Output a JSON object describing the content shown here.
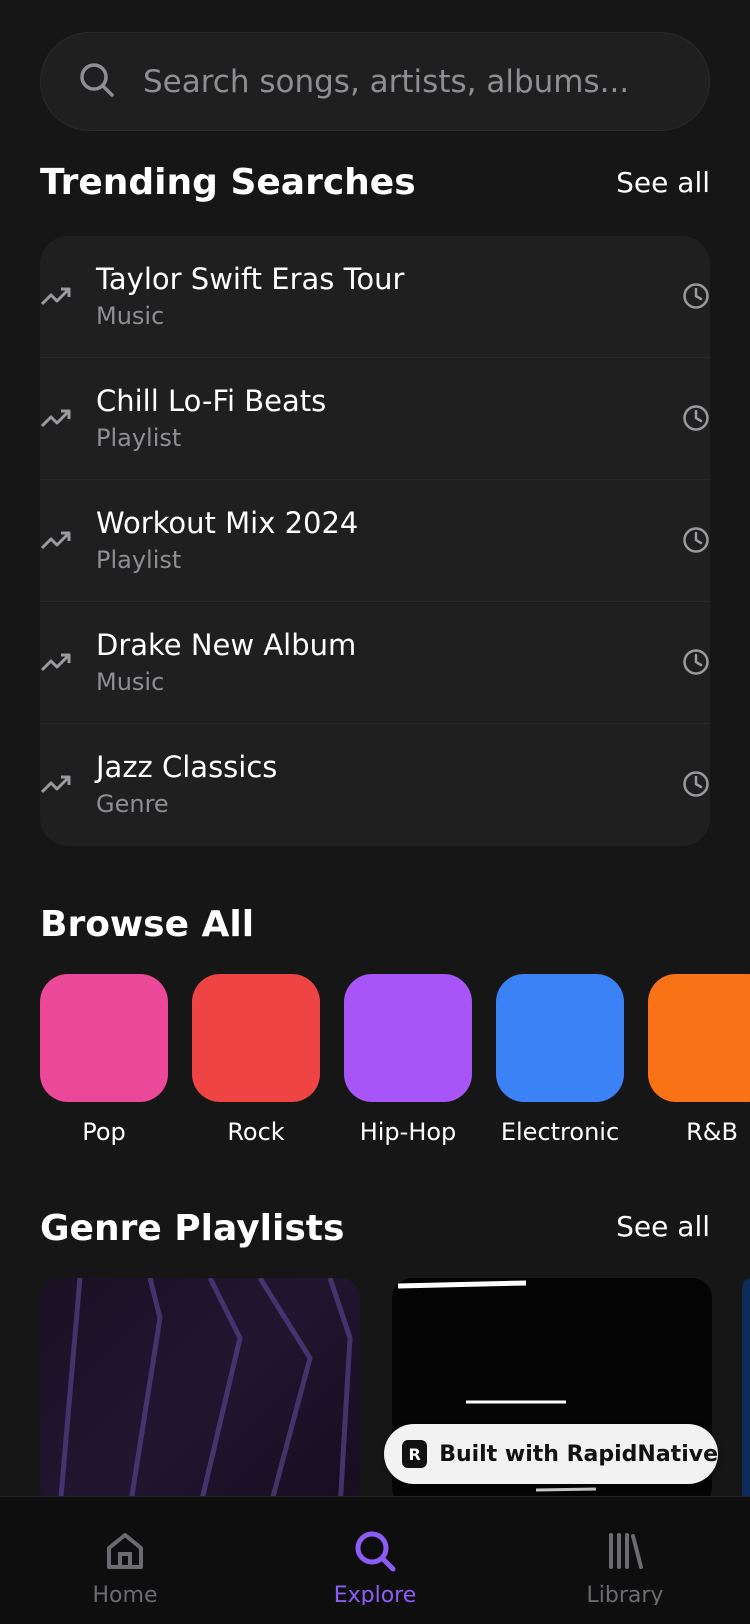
{
  "search": {
    "placeholder": "Search songs, artists, albums..."
  },
  "trending": {
    "title": "Trending Searches",
    "see_all": "See all",
    "items": [
      {
        "title": "Taylor Swift Eras Tour",
        "type": "Music"
      },
      {
        "title": "Chill Lo-Fi Beats",
        "type": "Playlist"
      },
      {
        "title": "Workout Mix 2024",
        "type": "Playlist"
      },
      {
        "title": "Drake New Album",
        "type": "Music"
      },
      {
        "title": "Jazz Classics",
        "type": "Genre"
      }
    ]
  },
  "browse": {
    "title": "Browse All",
    "genres": [
      {
        "label": "Pop",
        "color": "#ec4899"
      },
      {
        "label": "Rock",
        "color": "#ef4444"
      },
      {
        "label": "Hip-Hop",
        "color": "#a855f7"
      },
      {
        "label": "Electronic",
        "color": "#3b82f6"
      },
      {
        "label": "R&B",
        "color": "#f97316"
      }
    ]
  },
  "genre_playlists": {
    "title": "Genre Playlists",
    "see_all": "See all"
  },
  "badge": {
    "logo": "R",
    "text": "Built with RapidNative"
  },
  "tabbar": {
    "tabs": [
      {
        "label": "Home",
        "icon": "home-icon",
        "active": false
      },
      {
        "label": "Explore",
        "icon": "search-icon",
        "active": true
      },
      {
        "label": "Library",
        "icon": "library-icon",
        "active": false
      }
    ]
  },
  "colors": {
    "accent": "#8b5cf6",
    "background": "#161617",
    "card": "#1f1f20",
    "muted": "#8e8e93"
  }
}
